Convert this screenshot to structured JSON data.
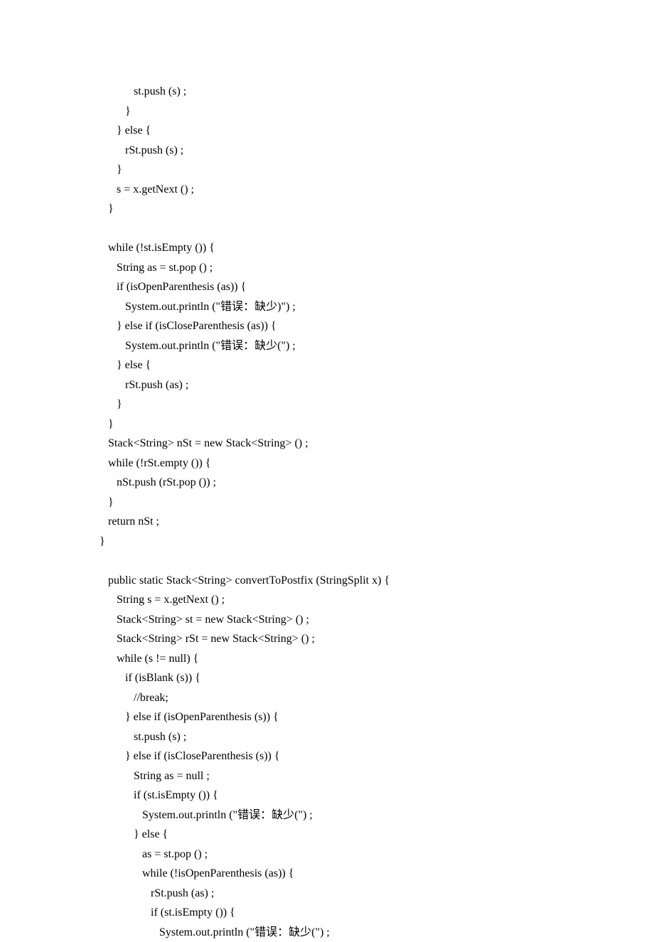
{
  "code_lines": [
    "            st.push (s) ;",
    "         }",
    "      } else {",
    "         rSt.push (s) ;",
    "      }",
    "      s = x.getNext () ;",
    "   }",
    "",
    "   while (!st.isEmpty ()) {",
    "      String as = st.pop () ;",
    "      if (isOpenParenthesis (as)) {",
    "         System.out.println (\"错误：缺少)\") ;",
    "      } else if (isCloseParenthesis (as)) {",
    "         System.out.println (\"错误：缺少(\") ;",
    "      } else {",
    "         rSt.push (as) ;",
    "      }",
    "   }",
    "   Stack<String> nSt = new Stack<String> () ;",
    "   while (!rSt.empty ()) {",
    "      nSt.push (rSt.pop ()) ;",
    "   }",
    "   return nSt ;",
    "}",
    "",
    "   public static Stack<String> convertToPostfix (StringSplit x) {",
    "      String s = x.getNext () ;",
    "      Stack<String> st = new Stack<String> () ;",
    "      Stack<String> rSt = new Stack<String> () ;",
    "      while (s != null) {",
    "         if (isBlank (s)) {",
    "            //break;",
    "         } else if (isOpenParenthesis (s)) {",
    "            st.push (s) ;",
    "         } else if (isCloseParenthesis (s)) {",
    "            String as = null ;",
    "            if (st.isEmpty ()) {",
    "               System.out.println (\"错误：缺少(\") ;",
    "            } else {",
    "               as = st.pop () ;",
    "               while (!isOpenParenthesis (as)) {",
    "                  rSt.push (as) ;",
    "                  if (st.isEmpty ()) {",
    "                     System.out.println (\"错误：缺少(\") ;"
  ]
}
